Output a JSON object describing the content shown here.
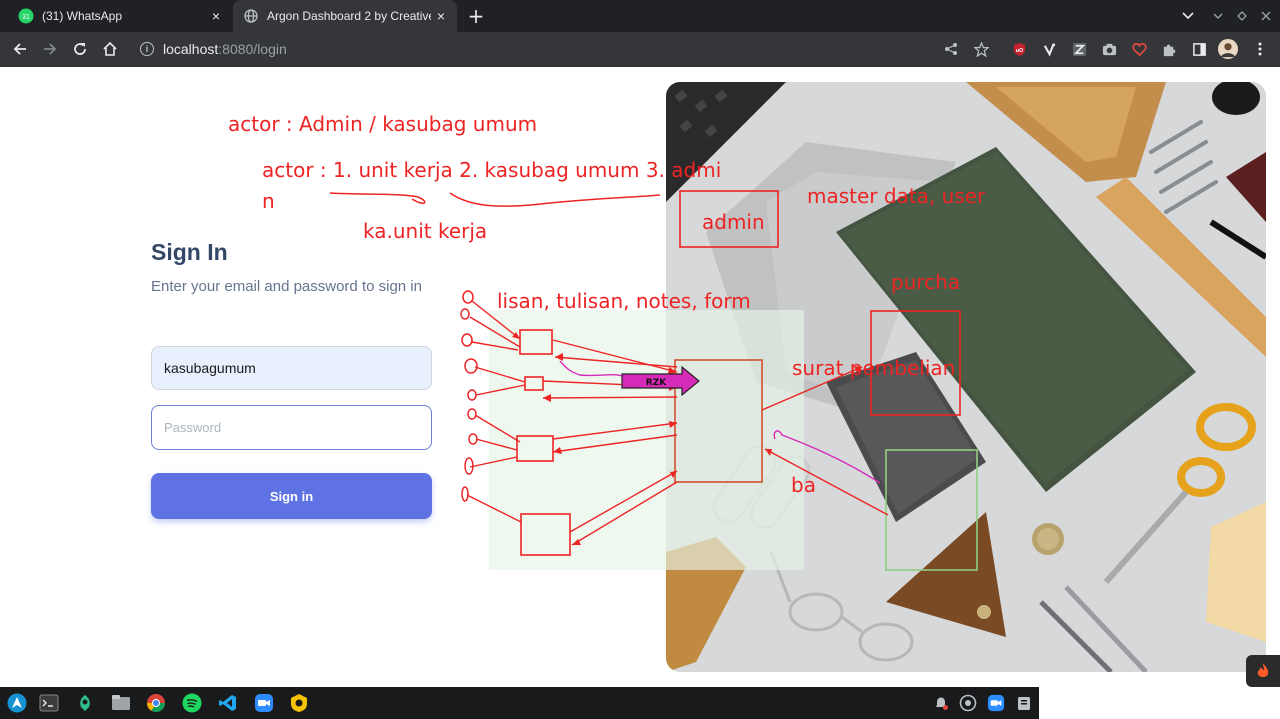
{
  "browser": {
    "tabs": [
      {
        "title": "(31) WhatsApp",
        "badge": "31",
        "icon": "whatsapp-icon"
      },
      {
        "title": "Argon Dashboard 2 by Creative",
        "icon": "globe-icon"
      }
    ],
    "close_glyph": "×",
    "new_tab_glyph": "+",
    "url_host": "localhost",
    "url_path": ":8080/login"
  },
  "login": {
    "title": "Sign In",
    "subtitle": "Enter your email and password to sign in",
    "email_value": "kasubagumum",
    "password_placeholder": "Password",
    "button_label": "Sign in"
  },
  "annotations": {
    "line1": "actor : Admin / kasubag umum",
    "line2a": "actor : 1. unit kerja 2. kasubag umum 3. admi",
    "line2b": "n",
    "line3": "ka.unit kerja",
    "line4": "lisan, tulisan, notes, form",
    "admin": "admin",
    "master": "master data, user",
    "purcha": "purcha",
    "surat": "surat pembelian",
    "ba": "ba",
    "rzk": "RZK"
  },
  "colors": {
    "annotation_red": "#ee2424",
    "magenta": "#d62ab8",
    "primary": "#5e72e4",
    "heading": "#344767",
    "muted": "#67748e"
  }
}
